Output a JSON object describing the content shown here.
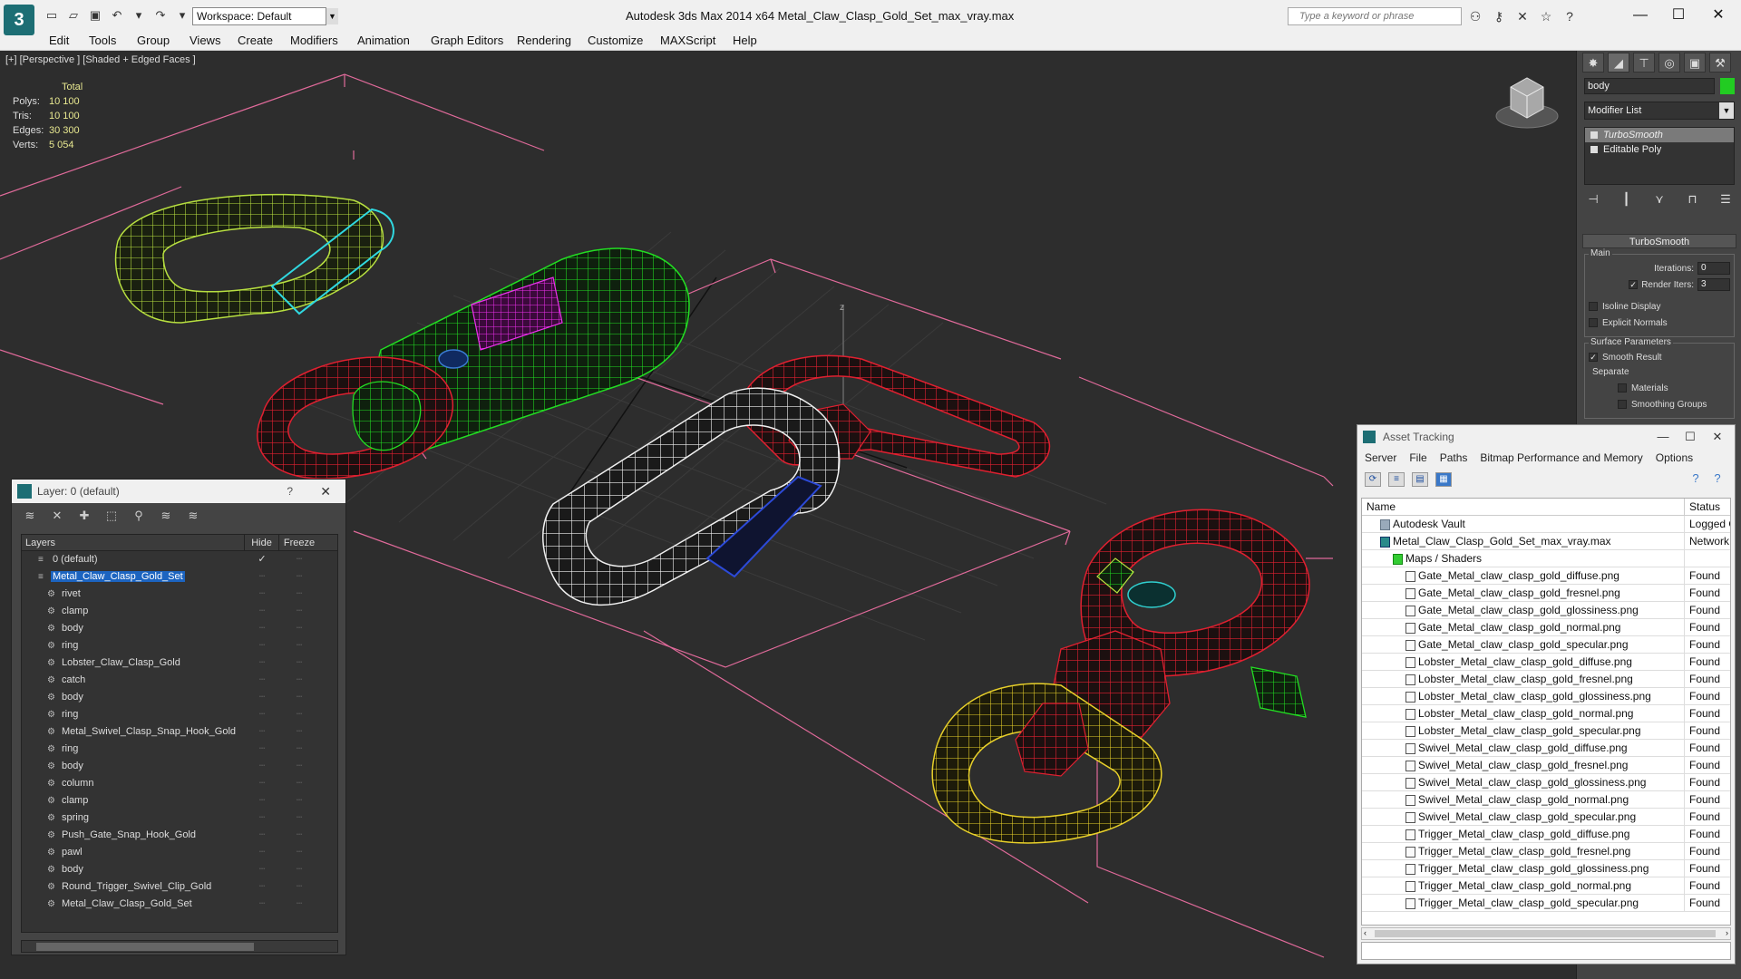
{
  "titlebar": {
    "workspace": "Workspace: Default",
    "title": "Autodesk 3ds Max  2014 x64      Metal_Claw_Clasp_Gold_Set_max_vray.max",
    "search_placeholder": "Type a keyword or phrase"
  },
  "menu": [
    "Edit",
    "Tools",
    "Group",
    "Views",
    "Create",
    "Modifiers",
    "Animation",
    "Graph Editors",
    "Rendering",
    "Customize",
    "MAXScript",
    "Help"
  ],
  "viewport": {
    "label": "[+] [Perspective ] [Shaded + Edged Faces ]",
    "stats": {
      "header": "Total",
      "rows": [
        {
          "k": "Polys:",
          "v": "10 100"
        },
        {
          "k": "Tris:",
          "v": "10 100"
        },
        {
          "k": "Edges:",
          "v": "30 300"
        },
        {
          "k": "Verts:",
          "v": "5 054"
        }
      ]
    },
    "axis_label": "z"
  },
  "command_panel": {
    "object_name": "body",
    "object_color": "#22cc22",
    "modifier_list": "Modifier List",
    "stack": [
      "TurboSmooth",
      "Editable Poly"
    ],
    "rollout_title": "TurboSmooth",
    "main_group": "Main",
    "iterations_label": "Iterations:",
    "iterations_value": "0",
    "render_iters_label": "Render Iters:",
    "render_iters_value": "3",
    "isoline": "Isoline Display",
    "explicit_normals": "Explicit Normals",
    "surface_group": "Surface Parameters",
    "smooth_result": "Smooth Result",
    "separate": "Separate",
    "materials": "Materials",
    "smoothing_groups": "Smoothing Groups"
  },
  "layer_window": {
    "title": "Layer: 0 (default)",
    "help": "?",
    "col_layers": "Layers",
    "col_hide": "Hide",
    "col_freeze": "Freeze",
    "rows": [
      {
        "label": "0 (default)",
        "indent": 1,
        "type": "layer"
      },
      {
        "label": "Metal_Claw_Clasp_Gold_Set",
        "indent": 1,
        "type": "layer",
        "selected": true
      },
      {
        "label": "rivet",
        "indent": 2,
        "type": "obj"
      },
      {
        "label": "clamp",
        "indent": 2,
        "type": "obj"
      },
      {
        "label": "body",
        "indent": 2,
        "type": "obj"
      },
      {
        "label": "ring",
        "indent": 2,
        "type": "obj"
      },
      {
        "label": "Lobster_Claw_Clasp_Gold",
        "indent": 2,
        "type": "obj"
      },
      {
        "label": "catch",
        "indent": 2,
        "type": "obj"
      },
      {
        "label": "body",
        "indent": 2,
        "type": "obj"
      },
      {
        "label": "ring",
        "indent": 2,
        "type": "obj"
      },
      {
        "label": "Metal_Swivel_Clasp_Snap_Hook_Gold",
        "indent": 2,
        "type": "obj"
      },
      {
        "label": "ring",
        "indent": 2,
        "type": "obj"
      },
      {
        "label": "body",
        "indent": 2,
        "type": "obj"
      },
      {
        "label": "column",
        "indent": 2,
        "type": "obj"
      },
      {
        "label": "clamp",
        "indent": 2,
        "type": "obj"
      },
      {
        "label": "spring",
        "indent": 2,
        "type": "obj"
      },
      {
        "label": "Push_Gate_Snap_Hook_Gold",
        "indent": 2,
        "type": "obj"
      },
      {
        "label": "pawl",
        "indent": 2,
        "type": "obj"
      },
      {
        "label": "body",
        "indent": 2,
        "type": "obj"
      },
      {
        "label": "Round_Trigger_Swivel_Clip_Gold",
        "indent": 2,
        "type": "obj"
      },
      {
        "label": "Metal_Claw_Clasp_Gold_Set",
        "indent": 2,
        "type": "obj"
      }
    ]
  },
  "asset_window": {
    "title": "Asset Tracking",
    "menu": [
      "Server",
      "File",
      "Paths",
      "Bitmap Performance and Memory",
      "Options"
    ],
    "col_name": "Name",
    "col_status": "Status",
    "rows": [
      {
        "name": "Autodesk Vault",
        "status": "Logged O",
        "indent": 1,
        "icon": "db"
      },
      {
        "name": "Metal_Claw_Clasp_Gold_Set_max_vray.max",
        "status": "Network",
        "indent": 2,
        "icon": "max"
      },
      {
        "name": "Maps / Shaders",
        "status": "",
        "indent": 3,
        "icon": "fold"
      },
      {
        "name": "Gate_Metal_claw_clasp_gold_diffuse.png",
        "status": "Found",
        "indent": 4,
        "icon": "file"
      },
      {
        "name": "Gate_Metal_claw_clasp_gold_fresnel.png",
        "status": "Found",
        "indent": 4,
        "icon": "file"
      },
      {
        "name": "Gate_Metal_claw_clasp_gold_glossiness.png",
        "status": "Found",
        "indent": 4,
        "icon": "file"
      },
      {
        "name": "Gate_Metal_claw_clasp_gold_normal.png",
        "status": "Found",
        "indent": 4,
        "icon": "file"
      },
      {
        "name": "Gate_Metal_claw_clasp_gold_specular.png",
        "status": "Found",
        "indent": 4,
        "icon": "file"
      },
      {
        "name": "Lobster_Metal_claw_clasp_gold_diffuse.png",
        "status": "Found",
        "indent": 4,
        "icon": "file"
      },
      {
        "name": "Lobster_Metal_claw_clasp_gold_fresnel.png",
        "status": "Found",
        "indent": 4,
        "icon": "file"
      },
      {
        "name": "Lobster_Metal_claw_clasp_gold_glossiness.png",
        "status": "Found",
        "indent": 4,
        "icon": "file"
      },
      {
        "name": "Lobster_Metal_claw_clasp_gold_normal.png",
        "status": "Found",
        "indent": 4,
        "icon": "file"
      },
      {
        "name": "Lobster_Metal_claw_clasp_gold_specular.png",
        "status": "Found",
        "indent": 4,
        "icon": "file"
      },
      {
        "name": "Swivel_Metal_claw_clasp_gold_diffuse.png",
        "status": "Found",
        "indent": 4,
        "icon": "file"
      },
      {
        "name": "Swivel_Metal_claw_clasp_gold_fresnel.png",
        "status": "Found",
        "indent": 4,
        "icon": "file"
      },
      {
        "name": "Swivel_Metal_claw_clasp_gold_glossiness.png",
        "status": "Found",
        "indent": 4,
        "icon": "file"
      },
      {
        "name": "Swivel_Metal_claw_clasp_gold_normal.png",
        "status": "Found",
        "indent": 4,
        "icon": "file"
      },
      {
        "name": "Swivel_Metal_claw_clasp_gold_specular.png",
        "status": "Found",
        "indent": 4,
        "icon": "file"
      },
      {
        "name": "Trigger_Metal_claw_clasp_gold_diffuse.png",
        "status": "Found",
        "indent": 4,
        "icon": "file"
      },
      {
        "name": "Trigger_Metal_claw_clasp_gold_fresnel.png",
        "status": "Found",
        "indent": 4,
        "icon": "file"
      },
      {
        "name": "Trigger_Metal_claw_clasp_gold_glossiness.png",
        "status": "Found",
        "indent": 4,
        "icon": "file"
      },
      {
        "name": "Trigger_Metal_claw_clasp_gold_normal.png",
        "status": "Found",
        "indent": 4,
        "icon": "file"
      },
      {
        "name": "Trigger_Metal_claw_clasp_gold_specular.png",
        "status": "Found",
        "indent": 4,
        "icon": "file"
      }
    ]
  }
}
